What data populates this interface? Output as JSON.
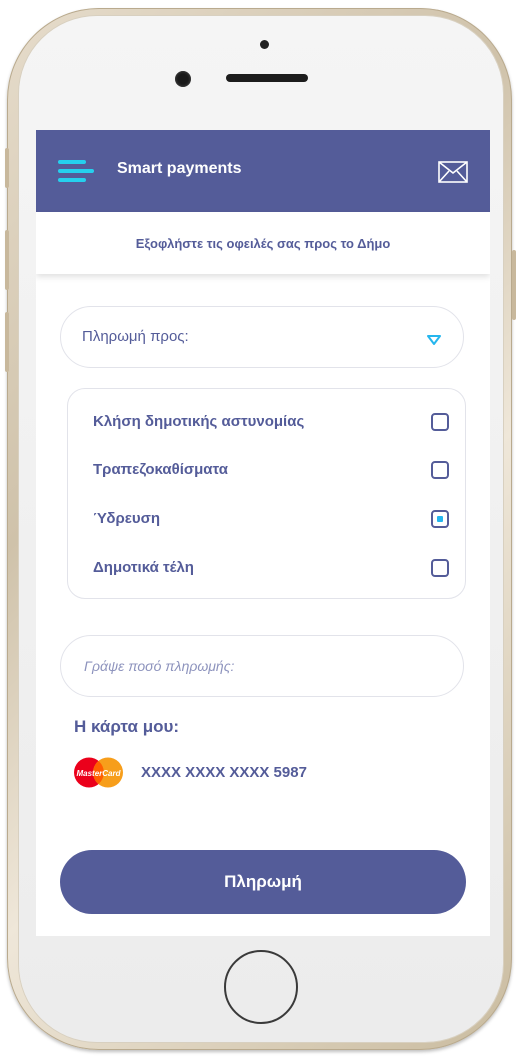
{
  "app_bar": {
    "title": "Smart payments",
    "menu_icon": "hamburger-menu-icon",
    "mail_icon": "envelope-icon"
  },
  "subheader": {
    "text": "Εξοφλήστε τις οφειλές σας προς το Δήμο"
  },
  "payment_to": {
    "label": "Πληρωμή προς:",
    "icon": "chevron-down-icon"
  },
  "options": [
    {
      "label": "Κλήση δημοτικής αστυνομίας",
      "checked": false
    },
    {
      "label": "Τραπεζοκαθίσματα",
      "checked": false
    },
    {
      "label": "Ύδρευση",
      "checked": true
    },
    {
      "label": "Δημοτικά τέλη",
      "checked": false
    }
  ],
  "amount": {
    "placeholder": "Γράψε ποσό πληρωμής:"
  },
  "card": {
    "title": "Η κάρτα μου:",
    "brand_logo_text": "MasterCard",
    "number": "XXXX XXXX XXXX 5987"
  },
  "pay_button": {
    "label": "Πληρωμή"
  },
  "colors": {
    "primary": "#545c99",
    "accent": "#25d0ee"
  }
}
